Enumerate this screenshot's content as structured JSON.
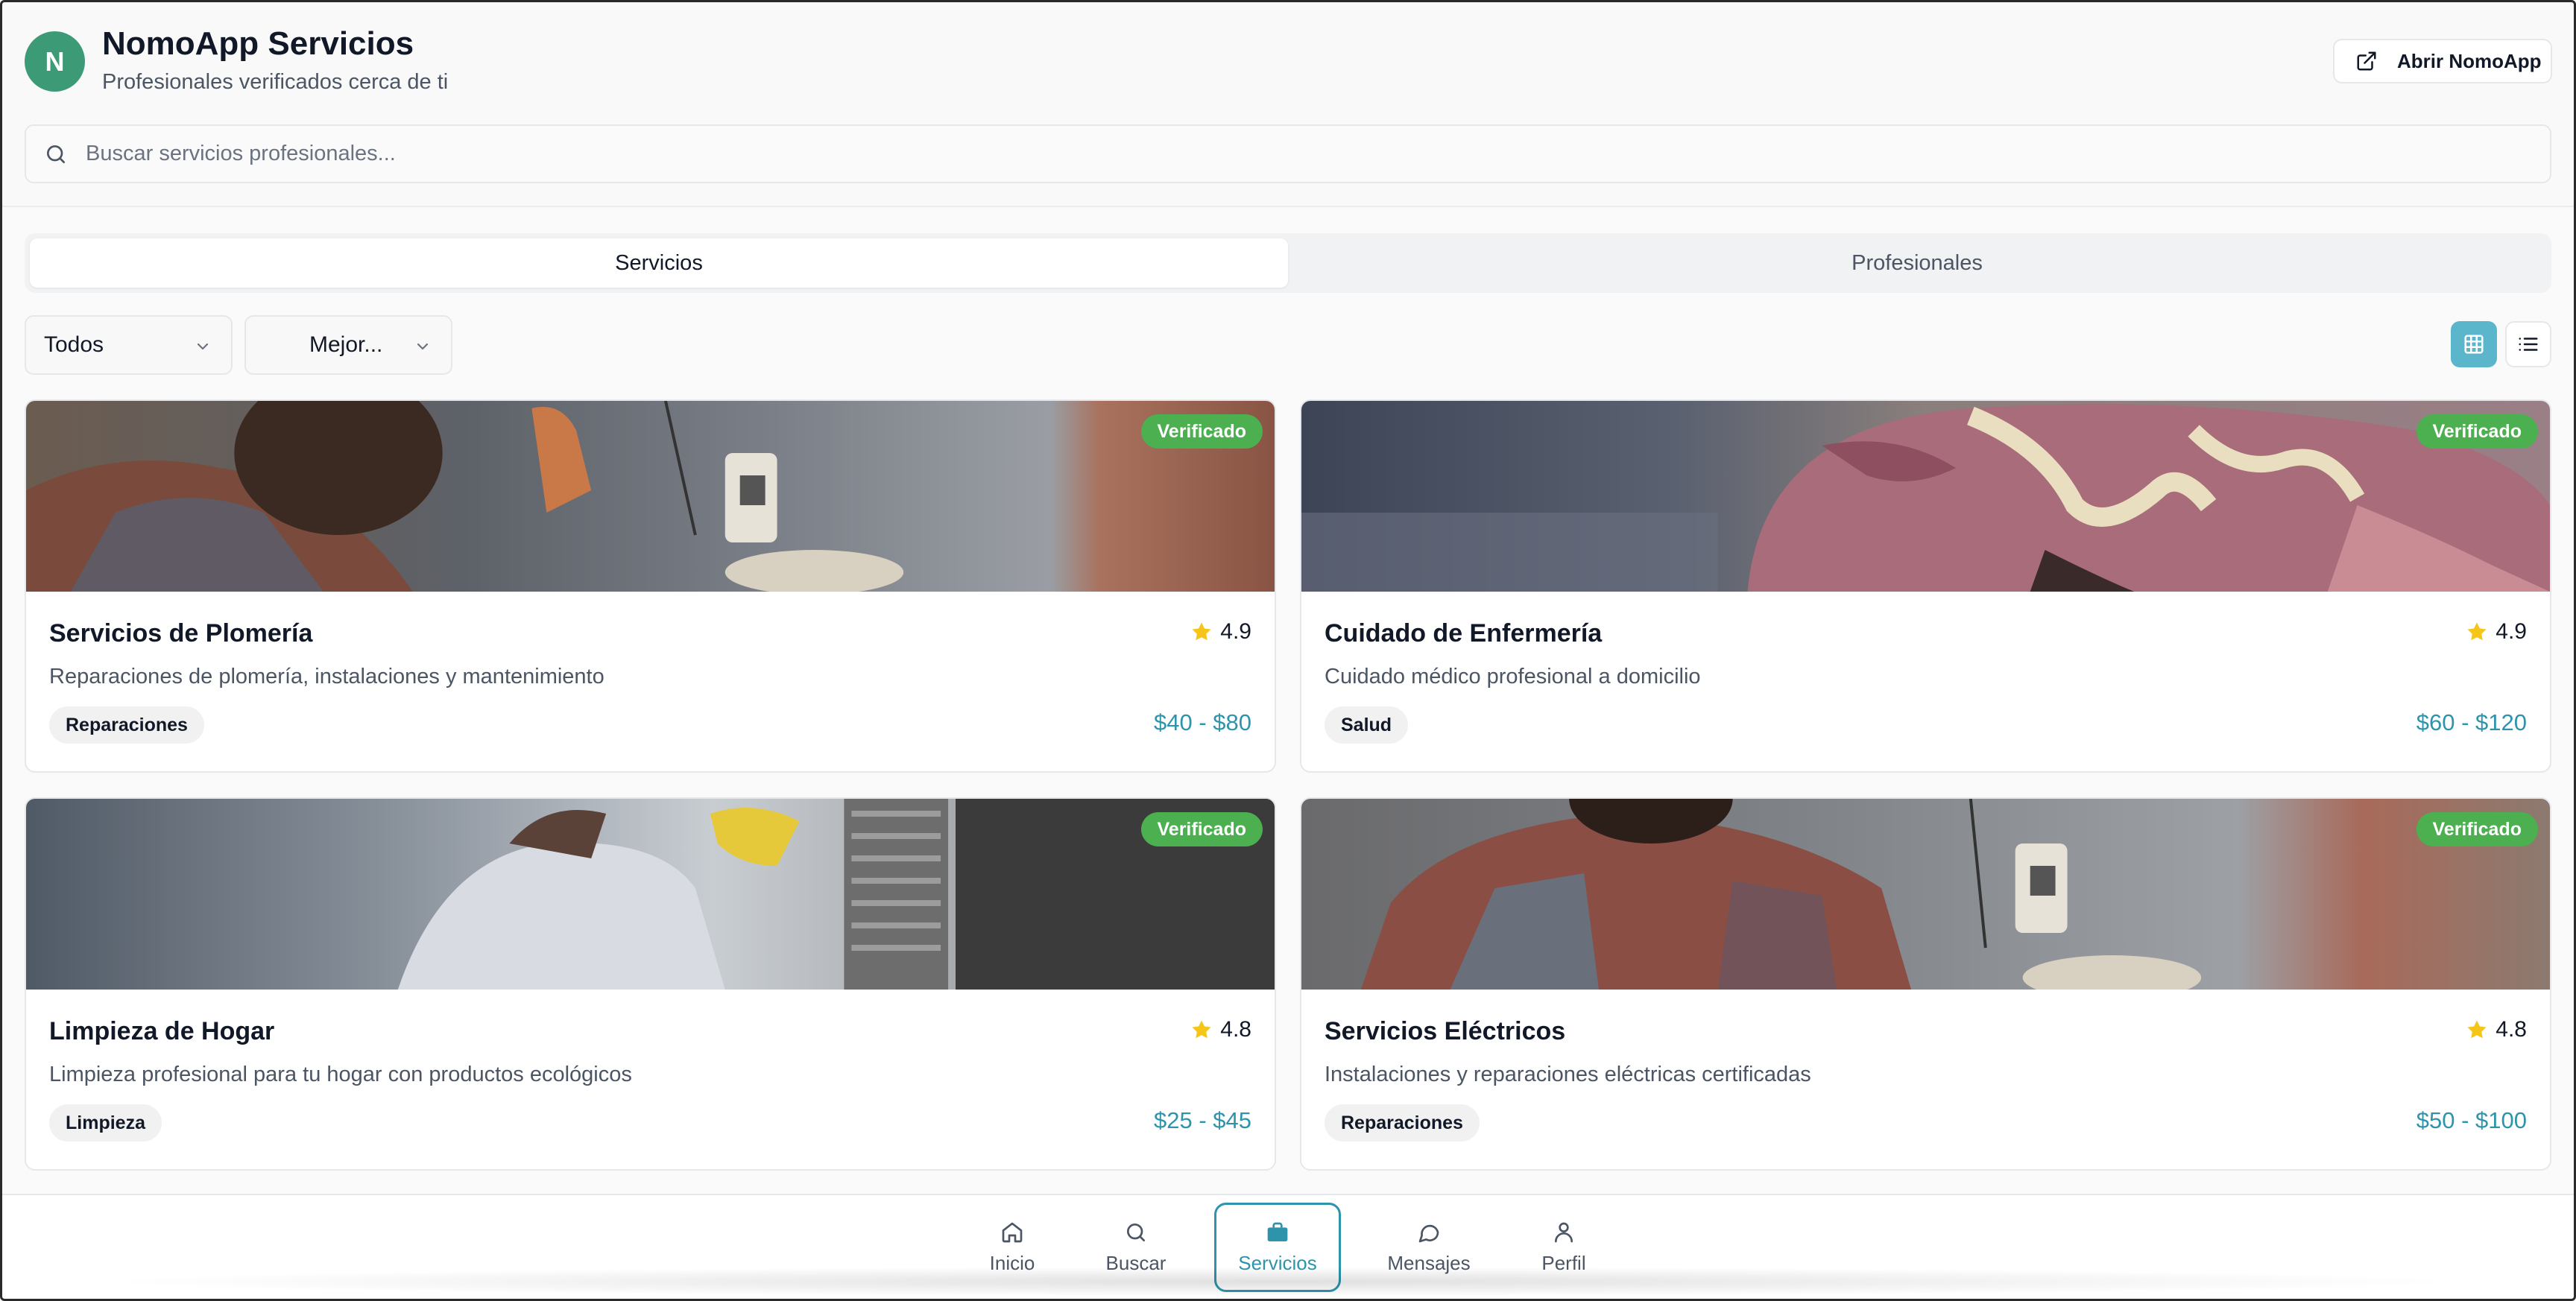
{
  "header": {
    "avatar_letter": "N",
    "title": "NomoApp Servicios",
    "subtitle": "Profesionales verificados cerca de ti",
    "open_button_label": "Abrir NomoApp",
    "open_button_icon": "external-link-icon"
  },
  "search": {
    "placeholder": "Buscar servicios profesionales...",
    "value": "",
    "icon": "search-icon"
  },
  "tabs": [
    {
      "label": "Servicios",
      "active": true
    },
    {
      "label": "Profesionales",
      "active": false
    }
  ],
  "filters": {
    "category": "Todos",
    "sort": "Mejor..."
  },
  "view_mode": {
    "selected": "grid",
    "grid_icon": "grid-icon",
    "list_icon": "list-icon"
  },
  "cards": [
    {
      "title": "Servicios de Plomería",
      "rating": "4.9",
      "description": "Reparaciones de plomería, instalaciones y mantenimiento",
      "tag": "Reparaciones",
      "price": "$40 - $80",
      "badge": "Verificado"
    },
    {
      "title": "Cuidado de Enfermería",
      "rating": "4.9",
      "description": "Cuidado médico profesional a domicilio",
      "tag": "Salud",
      "price": "$60 - $120",
      "badge": "Verificado"
    },
    {
      "title": "Limpieza de Hogar",
      "rating": "4.8",
      "description": "Limpieza profesional para tu hogar con productos ecológicos",
      "tag": "Limpieza",
      "price": "$25 - $45",
      "badge": "Verificado"
    },
    {
      "title": "Servicios Eléctricos",
      "rating": "4.8",
      "description": "Instalaciones y reparaciones eléctricas certificadas",
      "tag": "Reparaciones",
      "price": "$50 - $100",
      "badge": "Verificado"
    }
  ],
  "bottom_nav": [
    {
      "label": "Inicio",
      "icon": "home-icon",
      "active": false
    },
    {
      "label": "Buscar",
      "icon": "search-icon",
      "active": false
    },
    {
      "label": "Servicios",
      "icon": "briefcase-icon",
      "active": true
    },
    {
      "label": "Mensajes",
      "icon": "message-icon",
      "active": false
    },
    {
      "label": "Perfil",
      "icon": "user-icon",
      "active": false
    }
  ],
  "colors": {
    "accent": "#2e94ac",
    "avatar": "#3d9a76",
    "verified": "#4caf50",
    "star": "#f5c518"
  }
}
